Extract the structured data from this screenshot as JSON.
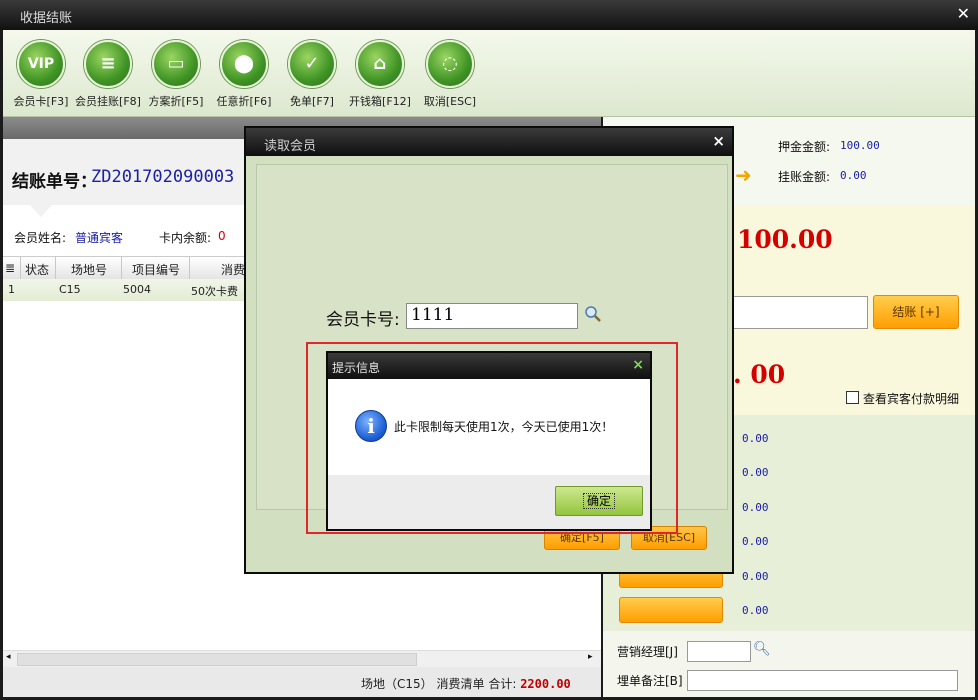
{
  "window": {
    "title": "收据结账"
  },
  "toolbar": {
    "buttons": [
      {
        "label": "会员卡[F3]",
        "icon": "vip-card-icon",
        "glyph": "VIP"
      },
      {
        "label": "会员挂账[F8]",
        "icon": "member-account-icon",
        "glyph": "≡"
      },
      {
        "label": "方案折[F5]",
        "icon": "plan-discount-icon",
        "glyph": "▭"
      },
      {
        "label": "任意折[F6]",
        "icon": "any-discount-icon",
        "glyph": "⬤"
      },
      {
        "label": "免单[F7]",
        "icon": "free-bill-icon",
        "glyph": "✓"
      },
      {
        "label": "开钱箱[F12]",
        "icon": "cash-drawer-icon",
        "glyph": "⌂"
      },
      {
        "label": "取消[ESC]",
        "icon": "cancel-icon",
        "glyph": "◌"
      }
    ]
  },
  "bill": {
    "label": "结账单号：",
    "number": "ZD201702090003"
  },
  "member": {
    "name_label": "会员姓名:",
    "name": "普通宾客",
    "balance_label": "卡内余额:",
    "balance": "0"
  },
  "grid": {
    "columns": [
      "状态",
      "场地号",
      "项目编号",
      "消费"
    ],
    "rows": [
      {
        "index": "1",
        "status": "",
        "site": "C15",
        "item_no": "5004",
        "consume": "50次卡费"
      }
    ]
  },
  "footer": {
    "site": "场地（C15）",
    "list": "消费清单",
    "total_label": "合计:",
    "total": "2200.00"
  },
  "right": {
    "deposit_label": "押金金额:",
    "deposit": "100.00",
    "account_label": "挂账金额:",
    "account": "0.00",
    "big_amount": "100.00",
    "second_amount": ". 00",
    "checkout_button": "结账 [+]",
    "view_guest_payment": "查看宾客付款明细",
    "values": [
      "0.00",
      "0.00",
      "0.00",
      "0.00",
      "0.00",
      "0.00"
    ],
    "manager_label": "营销经理[J]",
    "remark_label": "埋单备注[B]"
  },
  "read_member_dialog": {
    "title": "读取会员",
    "card_label": "会员卡号:",
    "card_value": "1111",
    "ok_button": "确定[F5]",
    "cancel_button": "取消[ESC]"
  },
  "message_box": {
    "title": "提示信息",
    "text": "此卡限制每天使用1次，今天已使用1次！",
    "ok_button": "确定"
  }
}
